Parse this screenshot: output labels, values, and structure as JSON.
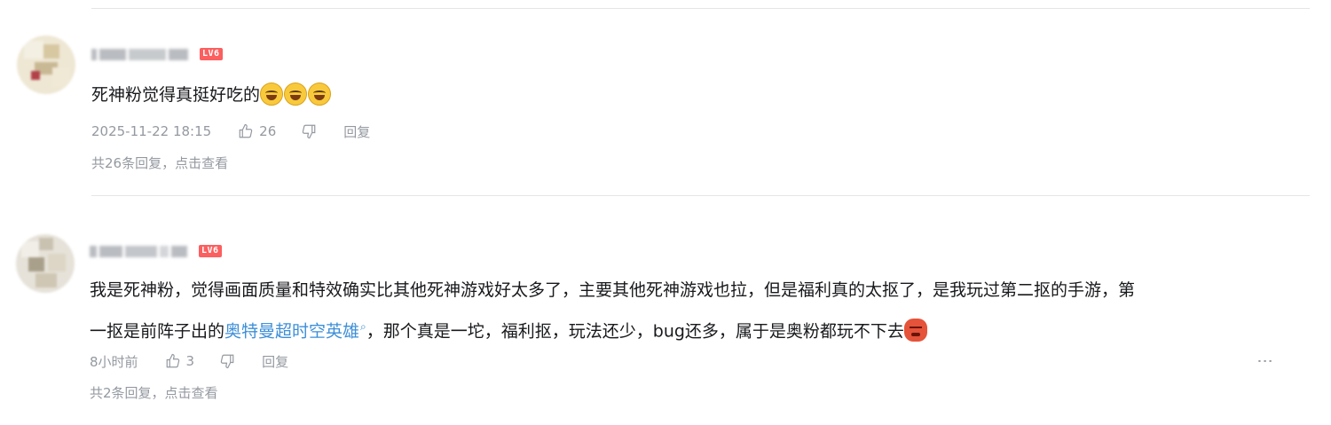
{
  "comments": [
    {
      "level": "LV6",
      "text": "死神粉觉得真挺好吃的",
      "emojis": [
        "laugh",
        "laugh",
        "laugh"
      ],
      "time": "2025-11-22 18:15",
      "likes": "26",
      "reply_label": "回复",
      "replies_summary": "共26条回复，点击查看"
    },
    {
      "level": "LV6",
      "text_before": "我是死神粉，觉得画面质量和特效确实比其他死神游戏好太多了，主要其他死神游戏也拉，但是福利真的太抠了，是我玩过第二抠的手游，第一抠是前阵子出的",
      "link_text": "奥特曼超时空英雄",
      "text_after": "，那个真是一坨，福利抠，玩法还少，bug还多，属于是奥粉都玩不下去",
      "emojis": [
        "angry"
      ],
      "time": "8小时前",
      "likes": "3",
      "reply_label": "回复",
      "more_label": "⋮",
      "replies_summary": "共2条回复，点击查看"
    }
  ],
  "colors": {
    "link": "#3d8fd8",
    "level_badge": "#fb5f5f",
    "meta_text": "#9499a0",
    "divider": "#e3e5e7"
  },
  "icons": {
    "like": "thumb-up-icon",
    "dislike": "thumb-down-icon",
    "search": "search-icon",
    "more": "more-vertical-icon"
  }
}
